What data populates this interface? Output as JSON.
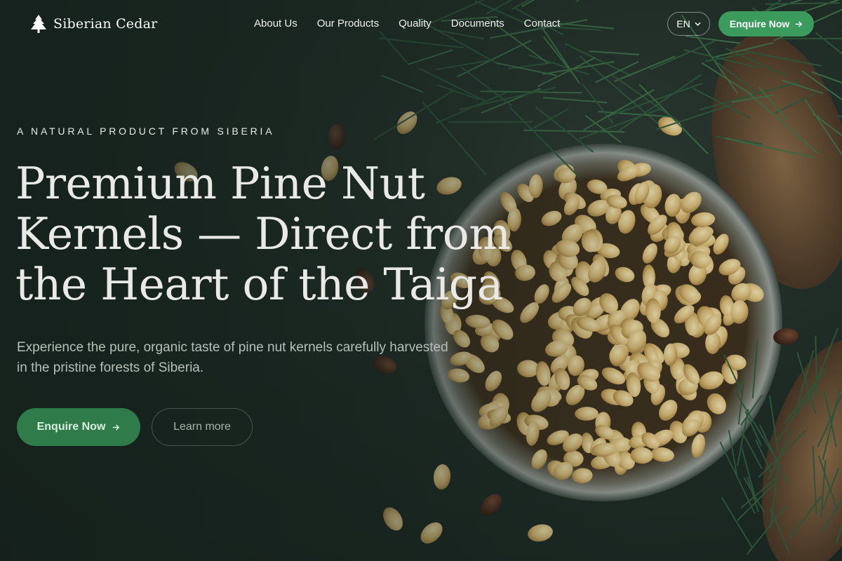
{
  "brand": {
    "name": "Siberian Cedar",
    "icon": "pine-tree-icon"
  },
  "nav": {
    "items": [
      {
        "label": "About Us"
      },
      {
        "label": "Our Products"
      },
      {
        "label": "Quality"
      },
      {
        "label": "Documents"
      },
      {
        "label": "Contact"
      }
    ],
    "language": "EN",
    "cta_label": "Enquire Now"
  },
  "hero": {
    "eyebrow": "A NATURAL PRODUCT FROM SIBERIA",
    "headline": "Premium Pine Nut Kernels — Direct from the Heart of the Taiga",
    "subtitle": "Experience the pure, organic taste of pine nut kernels carefully harvested in the pristine forests of Siberia.",
    "primary_label": "Enquire Now",
    "secondary_label": "Learn more"
  },
  "colors": {
    "accent": "#3a9b5c",
    "background": "#1c2a24"
  }
}
